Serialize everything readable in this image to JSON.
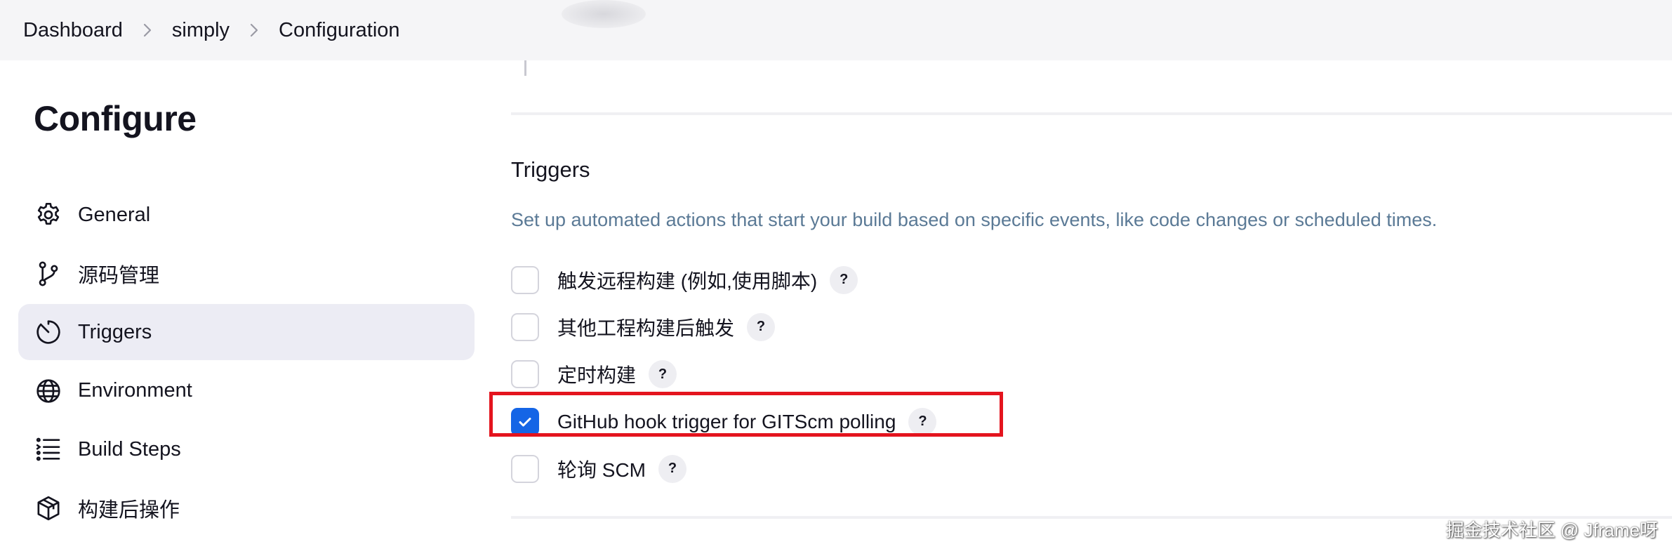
{
  "breadcrumb": {
    "items": [
      "Dashboard",
      "simply",
      "Configuration"
    ]
  },
  "sidebar": {
    "title": "Configure",
    "items": [
      {
        "label": "General",
        "icon": "gear-icon"
      },
      {
        "label": "源码管理",
        "icon": "source-branch-icon"
      },
      {
        "label": "Triggers",
        "icon": "clock-icon",
        "active": true
      },
      {
        "label": "Environment",
        "icon": "globe-icon"
      },
      {
        "label": "Build Steps",
        "icon": "list-steps-icon"
      },
      {
        "label": "构建后操作",
        "icon": "package-icon"
      }
    ]
  },
  "triggers": {
    "title": "Triggers",
    "description": "Set up automated actions that start your build based on specific events, like code changes or scheduled times.",
    "help_label": "?",
    "options": [
      {
        "label": "触发远程构建 (例如,使用脚本)",
        "checked": false
      },
      {
        "label": "其他工程构建后触发",
        "checked": false
      },
      {
        "label": "定时构建",
        "checked": false
      },
      {
        "label": "GitHub hook trigger for GITScm polling",
        "checked": true
      },
      {
        "label": "轮询 SCM",
        "checked": false
      }
    ]
  },
  "watermark": "掘金技术社区 @ Jframe呀",
  "colors": {
    "accent": "#1565e6",
    "highlight_border": "#e4141e",
    "description_text": "#5b7a96",
    "active_nav_bg": "#ececf4"
  }
}
